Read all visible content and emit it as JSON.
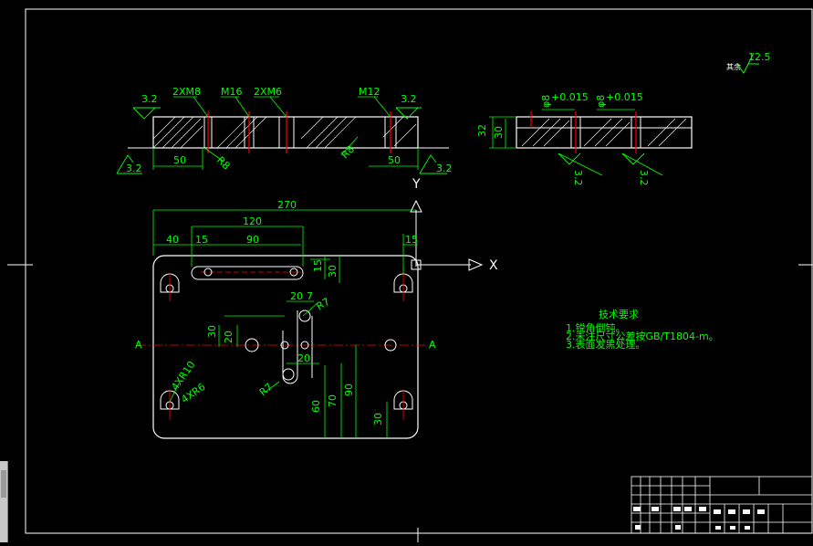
{
  "drawing": {
    "roughness_main": "12.5",
    "roughness_note": "其余",
    "roughness": [
      "3.2",
      "3.2",
      "3.2",
      "3.2",
      "3.2",
      "3.2"
    ],
    "front_view": {
      "holes": [
        "2XM8",
        "M16",
        "2XM6",
        "M12"
      ],
      "radius_left": "R8",
      "radius_right": "R8",
      "dim_left": "50",
      "dim_right": "50"
    },
    "side_view": {
      "bore1": "φ8",
      "bore1_tol": "+0.015",
      "bore2": "φ8",
      "bore2_tol": "+0.015",
      "height_total": "32",
      "height_inner": "30"
    },
    "plan_view": {
      "overall_width": "270",
      "slot_span": "120",
      "left_offset": "40",
      "slot_inner_offset": "15",
      "slot_length": "90",
      "right_offset": "15",
      "slot_v1": "15",
      "slot_v2": "30",
      "dim_20a": "20",
      "dim_7": "7",
      "radius_top": "R7",
      "dim_30": "30",
      "dim_20b": "20",
      "dim_20c": "20",
      "radius_bottom": "R7",
      "dim_60": "60",
      "dim_70": "70",
      "dim_90": "90",
      "dim_30b": "30",
      "slot_note1": "4XR10",
      "slot_note2": "4XR6",
      "section_a_left": "A",
      "section_a_right": "A",
      "axis_x": "X",
      "axis_y": "Y"
    },
    "tech_req": {
      "title": "技术要求",
      "lines": [
        "1.锐角倒钝。",
        "2.未注尺寸公差按GB/T1804-m。",
        "3.表面发黑处理。"
      ]
    }
  }
}
